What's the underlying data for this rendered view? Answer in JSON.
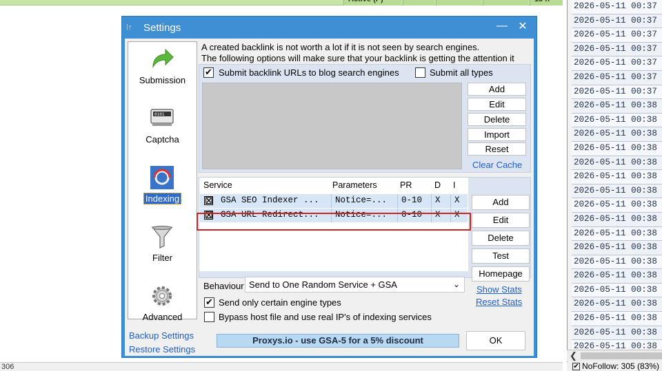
{
  "background": {
    "top_status": "Active (P)",
    "top_right": "15 h",
    "log_rows": [
      "2026-05-11 00:37",
      "2026-05-11 00:37",
      "2026-05-11 00:37",
      "2026-05-11 00:37",
      "2026-05-11 00:37",
      "2026-05-11 00:37",
      "2026-05-11 00:37",
      "2026-05-11 00:38",
      "2026-05-11 00:38",
      "2026-05-11 00:38",
      "2026-05-11 00:38",
      "2026-05-11 00:38",
      "2026-05-11 00:38",
      "2026-05-11 00:38",
      "2026-05-11 00:38",
      "2026-05-11 00:38",
      "2026-05-11 00:38",
      "2026-05-11 00:38",
      "2026-05-11 00:38",
      "2026-05-11 00:38",
      "2026-05-11 00:38",
      "2026-05-11 00:38",
      "2026-05-11 00:38",
      "2026-05-11 00:38",
      "2026-05-11 00:38"
    ],
    "log_footer": "NoFollow: 305 (83%)",
    "bottom_left": "306",
    "scroll_left_arrow": "❮"
  },
  "window": {
    "title": "Settings",
    "minimize": "—",
    "close": "✕"
  },
  "sidebar": {
    "items": [
      {
        "label": "Submission",
        "icon": "green-arrow-icon"
      },
      {
        "label": "Captcha",
        "icon": "captcha-icon"
      },
      {
        "label": "Indexing",
        "icon": "indexing-icon"
      },
      {
        "label": "Filter",
        "icon": "funnel-icon"
      },
      {
        "label": "Advanced",
        "icon": "gear-icon"
      }
    ],
    "backup": "Backup Settings",
    "restore": "Restore Settings"
  },
  "top": {
    "desc_line1": "A created backlink is not worth a lot if it is not seen by search engines.",
    "desc_line2": "The following options will make sure that your backlink is getting the attention it needs.",
    "submit_blog_label": "Submit backlink URLs to blog search engines",
    "submit_blog_checked": true,
    "submit_all_label": "Submit all types",
    "submit_all_checked": false,
    "buttons": {
      "add": "Add",
      "edit": "Edit",
      "delete": "Delete",
      "import": "Import",
      "reset": "Reset"
    },
    "clear_cache": "Clear Cache"
  },
  "services": {
    "headers": {
      "service": "Service",
      "parameters": "Parameters",
      "pr": "PR",
      "d": "D",
      "i": "I"
    },
    "rows": [
      {
        "checked": "☒",
        "service": "GSA SEO Indexer ...",
        "parameters": "Notice=...",
        "pr": "0-10",
        "d": "X",
        "i": "X"
      },
      {
        "checked": "☒",
        "service": "GSA URL Redirect...",
        "parameters": "Notice=...",
        "pr": "0-10",
        "d": "X",
        "i": "X"
      }
    ],
    "buttons": {
      "add": "Add",
      "edit": "Edit",
      "delete": "Delete",
      "test": "Test",
      "homepage": "Homepage"
    },
    "show_stats": "Show Stats",
    "reset_stats": "Reset Stats"
  },
  "behaviour": {
    "label": "Behaviour",
    "value": "Send to One Random Service + GSA",
    "only_engines_label": "Send only certain engine types",
    "only_engines_checked": true,
    "bypass_label": "Bypass host file and use real IP's of indexing services",
    "bypass_checked": false
  },
  "footer": {
    "promo": "Proxys.io - use GSA-5 for a 5% discount",
    "ok": "OK"
  }
}
